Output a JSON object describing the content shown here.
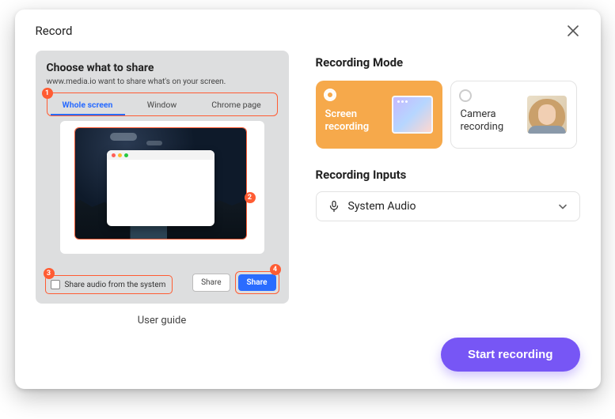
{
  "modal": {
    "title": "Record"
  },
  "guide": {
    "share_title": "Choose what to share",
    "share_subtitle": "www.media.io want to share what's on your screen.",
    "tabs": {
      "whole_screen": "Whole screen",
      "window": "Window",
      "chrome_page": "Chrome page"
    },
    "badges": {
      "b1": "1",
      "b2": "2",
      "b3": "3",
      "b4": "4"
    },
    "share_audio_label": "Share audio from the system",
    "share_btn": "Share",
    "share_btn_primary": "Share",
    "caption": "User guide"
  },
  "right": {
    "mode_title": "Recording Mode",
    "modes": {
      "screen": "Screen recording",
      "camera": "Camera recording"
    },
    "inputs_title": "Recording Inputs",
    "input_selected": "System Audio",
    "start_label": "Start recording"
  },
  "colors": {
    "accent_orange": "#ff5c33",
    "tab_blue": "#2a6cff",
    "mode_orange": "#f6a94b",
    "primary_purple": "#7756f5"
  }
}
